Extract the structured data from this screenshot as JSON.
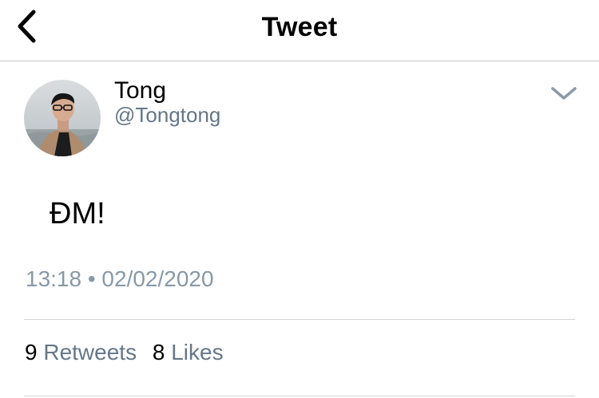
{
  "nav": {
    "title": "Tweet",
    "back_icon": "chevron-left-icon"
  },
  "tweet": {
    "author_name": "Tong",
    "author_handle": "@Tongtong",
    "text": "ĐM!",
    "timestamp": "13:18 • 02/02/2020",
    "more_icon": "chevron-down-icon"
  },
  "stats": {
    "retweets_count": "9",
    "retweets_label": "Retweets",
    "likes_count": "8",
    "likes_label": "Likes"
  },
  "colors": {
    "secondary_text": "#657786",
    "timestamp_text": "#8899a6",
    "divider": "#d0d4d8"
  }
}
